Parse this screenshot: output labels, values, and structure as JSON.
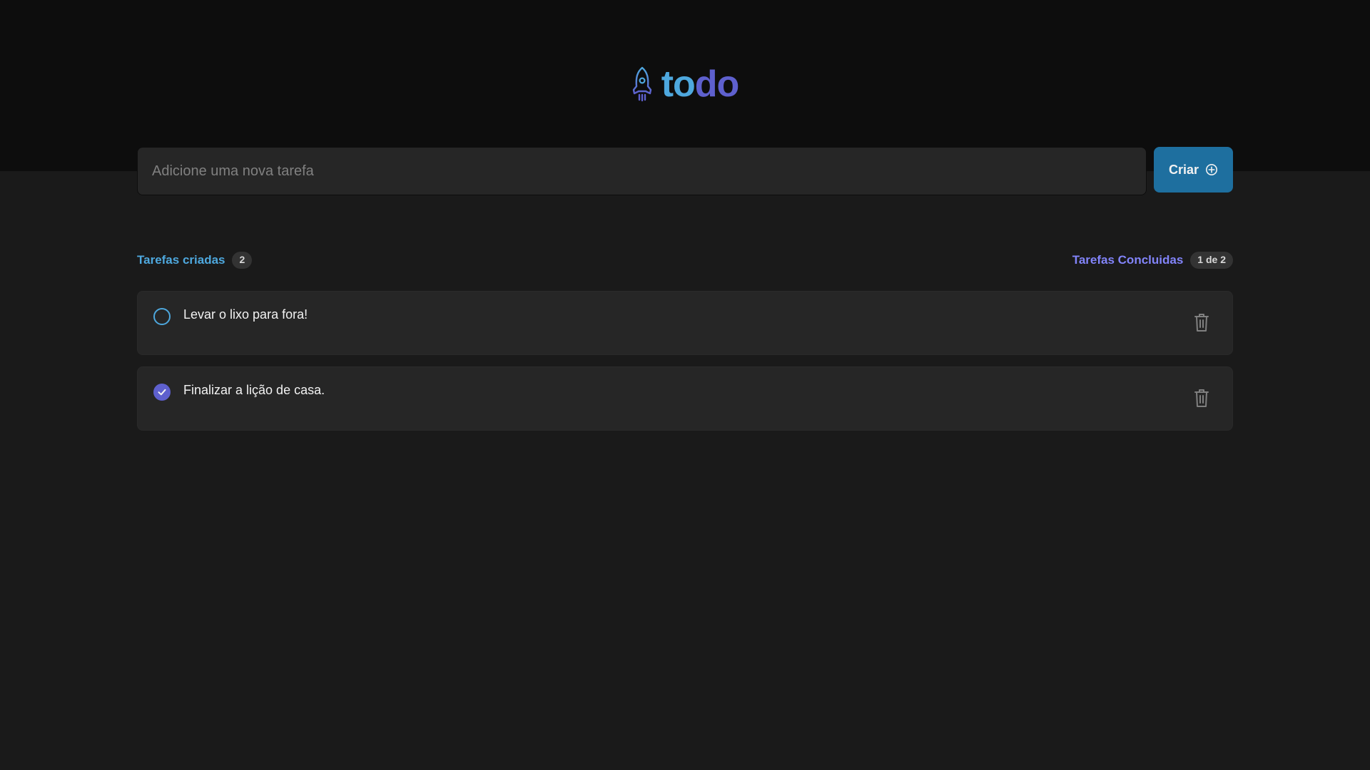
{
  "header": {
    "logo_part_a": "to",
    "logo_part_b": "do",
    "logo_icon": "rocket-icon",
    "colors": {
      "blue": "#4ea8de",
      "purple": "#5e60ce",
      "background": "#0d0d0d"
    }
  },
  "form": {
    "input_value": "",
    "input_placeholder": "Adicione uma nova tarefa",
    "create_label": "Criar",
    "create_icon": "plus-circle-icon",
    "create_color": "#1e6f9f"
  },
  "summary": {
    "created_label": "Tarefas criadas",
    "created_count": "2",
    "done_label": "Tarefas Concluidas",
    "done_count": "1 de 2"
  },
  "tasks": [
    {
      "text": "Levar o lixo para fora!",
      "completed": false,
      "delete_icon": "trash-icon"
    },
    {
      "text": "Finalizar a lição de casa.",
      "completed": true,
      "delete_icon": "trash-icon"
    }
  ]
}
